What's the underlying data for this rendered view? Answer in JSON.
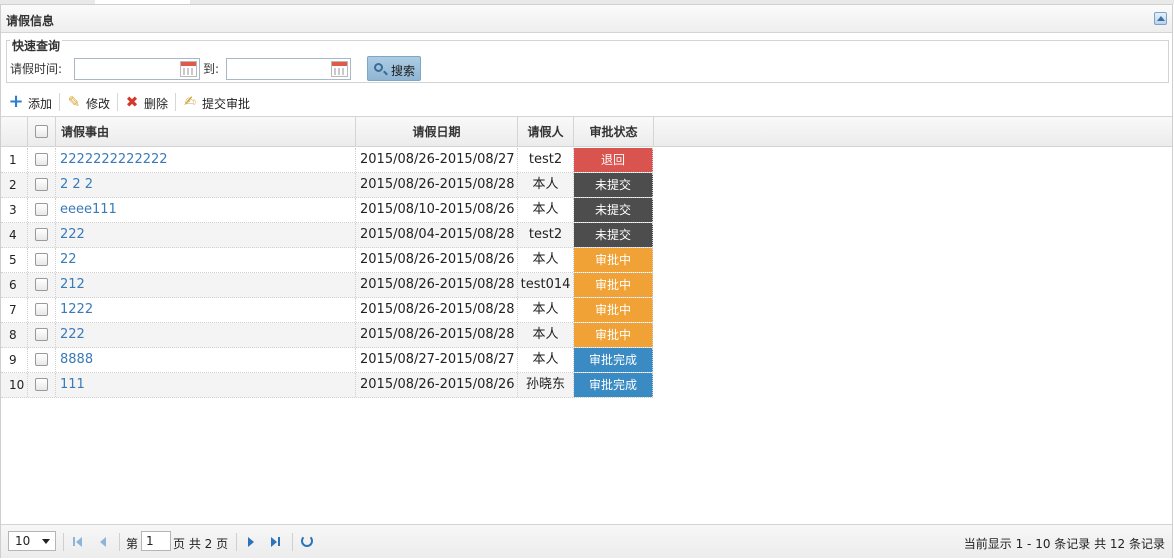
{
  "panel": {
    "title": "请假信息"
  },
  "query": {
    "legend": "快速查询",
    "time_label": "请假时间:",
    "to_label": "到:",
    "start_value": "",
    "end_value": "",
    "search_label": "搜索"
  },
  "toolbar": {
    "add_label": "添加",
    "edit_label": "修改",
    "delete_label": "删除",
    "submit_label": "提交审批"
  },
  "table": {
    "headers": [
      "请假事由",
      "请假日期",
      "请假人",
      "审批状态"
    ],
    "rows": [
      {
        "num": "1",
        "reason": "2222222222222",
        "date": "2015/08/26-2015/08/27",
        "person": "test2",
        "status": "退回"
      },
      {
        "num": "2",
        "reason": "2 2 2",
        "date": "2015/08/26-2015/08/28",
        "person": "本人",
        "status": "未提交"
      },
      {
        "num": "3",
        "reason": "eeee111",
        "date": "2015/08/10-2015/08/26",
        "person": "本人",
        "status": "未提交"
      },
      {
        "num": "4",
        "reason": "222",
        "date": "2015/08/04-2015/08/28",
        "person": "test2",
        "status": "未提交"
      },
      {
        "num": "5",
        "reason": "22",
        "date": "2015/08/26-2015/08/26",
        "person": "本人",
        "status": "审批中"
      },
      {
        "num": "6",
        "reason": "212",
        "date": "2015/08/26-2015/08/28",
        "person": "test014",
        "status": "审批中"
      },
      {
        "num": "7",
        "reason": "1222",
        "date": "2015/08/26-2015/08/28",
        "person": "本人",
        "status": "审批中"
      },
      {
        "num": "8",
        "reason": "222",
        "date": "2015/08/26-2015/08/28",
        "person": "本人",
        "status": "审批中"
      },
      {
        "num": "9",
        "reason": "8888",
        "date": "2015/08/27-2015/08/27",
        "person": "本人",
        "status": "审批完成"
      },
      {
        "num": "10",
        "reason": "111",
        "date": "2015/08/26-2015/08/26",
        "person": "孙晓东",
        "status": "审批完成"
      }
    ],
    "status_colors": {
      "退回": "#d9534f",
      "未提交": "#4d4d4d",
      "审批中": "#f0a236",
      "审批完成": "#3a8ac4"
    }
  },
  "pager": {
    "page_size": "10",
    "page_prefix": "第",
    "current_page": "1",
    "page_suffix": "页 共 2 页",
    "info": "当前显示 1 - 10 条记录 共 12 条记录"
  }
}
